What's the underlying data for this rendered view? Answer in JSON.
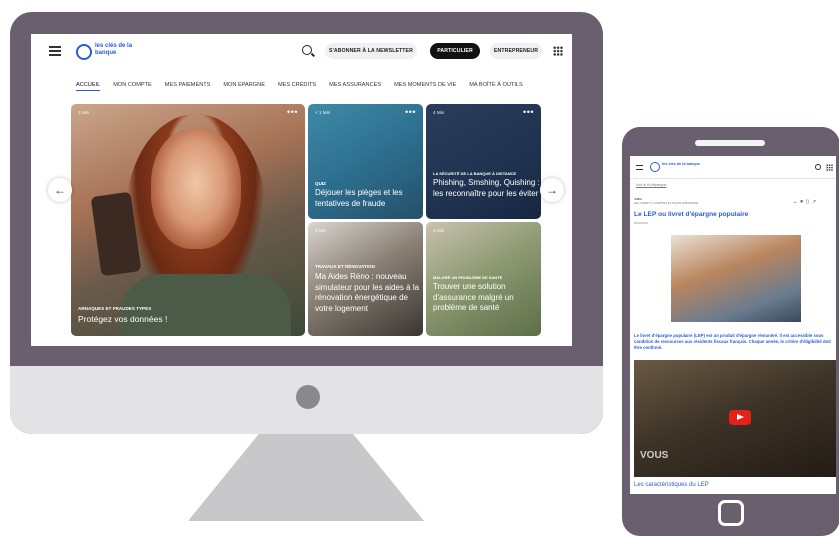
{
  "desktop": {
    "brand": "les clés de la banque",
    "newsletter_label": "S'ABONNER À LA NEWSLETTER",
    "particulier_label": "PARTICULIER",
    "entrepreneur_label": "ENTREPRENEUR",
    "nav": [
      "ACCUEIL",
      "MON COMPTE",
      "MES PAIEMENTS",
      "MON ÉPARGNE",
      "MES CRÉDITS",
      "MES ASSURANCES",
      "MES MOMENTS DE VIE",
      "MA BOÎTE À OUTILS"
    ],
    "cards": {
      "big": {
        "time": "2 Min",
        "category": "ARNAQUES ET FRAUDES TYPES",
        "title": "Protégez vos données !"
      },
      "m1": {
        "time": "< 1 Min",
        "category": "QUIZ",
        "title": "Déjouer les pièges et les tentatives de fraude"
      },
      "m2": {
        "time": "4 Min",
        "category": "LA SÉCURITÉ DE LA BANQUE À DISTANCE",
        "title": "Phishing, Smshing, Quishing : les reconnaître pour les éviter"
      },
      "m3": {
        "time": "2 Min",
        "category": "TRAVAUX ET RÉNOVATION",
        "title": "Ma Aides Réno : nouveau simulateur pour les aides à la rénovation énergétique de votre logement"
      },
      "m4": {
        "time": "2 Min",
        "category": "MALGRÉ UN PROBLÈME DE SANTÉ",
        "title": "Trouver une solution d'assurance malgré un problème de santé"
      }
    }
  },
  "mobile": {
    "brand": "les clés de la banque",
    "back_link": "Voir le fil d'épargne",
    "time": "4 Min",
    "breadcrumb": "LES LIVRETS, COMPTES ET PLANS D'ÉPARGNE",
    "title": "Le LEP ou livret d'épargne populaire",
    "date": "28/02/2024",
    "body": "Le livret d'épargne populaire (LEP) est un produit d'épargne rémunéré. Il est accessible sous condition de ressources aux résidents fiscaux français. Chaque année, le critère d'éligibilité doit être confirmé.",
    "video_overlay": "VOUS",
    "caption": "Les caractéristiques du LEP"
  },
  "colors": {
    "brand_blue": "#2a5bd7",
    "frame": "#6a5f6f",
    "particulier_bg": "#111111"
  },
  "icons": [
    "hamburger-icon",
    "search-icon",
    "grid-menu-icon",
    "arrow-left-icon",
    "arrow-right-icon",
    "more-icon",
    "play-icon"
  ]
}
